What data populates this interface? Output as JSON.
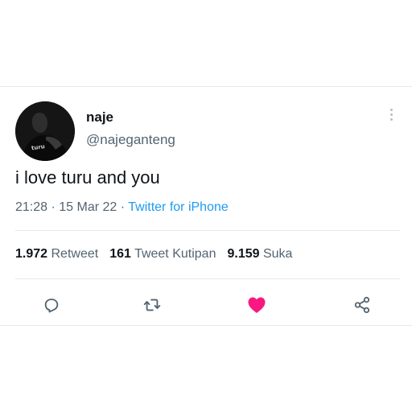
{
  "tweet": {
    "display_name": "naje",
    "handle": "@najeganteng",
    "text": "i love turu and you",
    "time": "21:28",
    "separator": "·",
    "date": "15 Mar 22",
    "source": "Twitter for iPhone",
    "avatar_caption": "turu"
  },
  "stats": {
    "retweet_count": "1.972",
    "retweet_label": "Retweet",
    "quote_count": "161",
    "quote_label": "Tweet Kutipan",
    "like_count": "9.159",
    "like_label": "Suka"
  },
  "actions": {
    "reply_icon": "reply-icon",
    "retweet_icon": "retweet-icon",
    "like_icon": "heart-icon",
    "share_icon": "share-icon"
  },
  "colors": {
    "text": "#0f1419",
    "muted": "#536471",
    "link": "#1d9bf0",
    "like": "#f91880"
  }
}
